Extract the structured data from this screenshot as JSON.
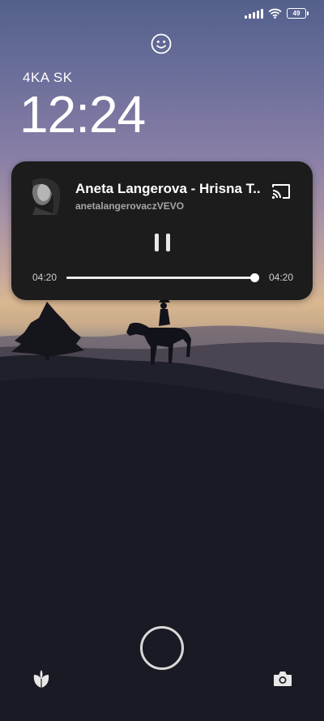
{
  "status_bar": {
    "battery": "49"
  },
  "lockscreen": {
    "carrier": "4KA SK",
    "time": "12:24"
  },
  "media": {
    "title": "Aneta Langerova - Hrisna T...",
    "artist": "anetalangerovaczVEVO",
    "elapsed": "04:20",
    "total": "04:20",
    "progress": 1.0
  },
  "icons": {
    "face": "smiley-icon",
    "cast": "cast-icon",
    "pause": "pause-icon",
    "left_shortcut": "leaf-icon",
    "right_shortcut": "camera-icon"
  }
}
